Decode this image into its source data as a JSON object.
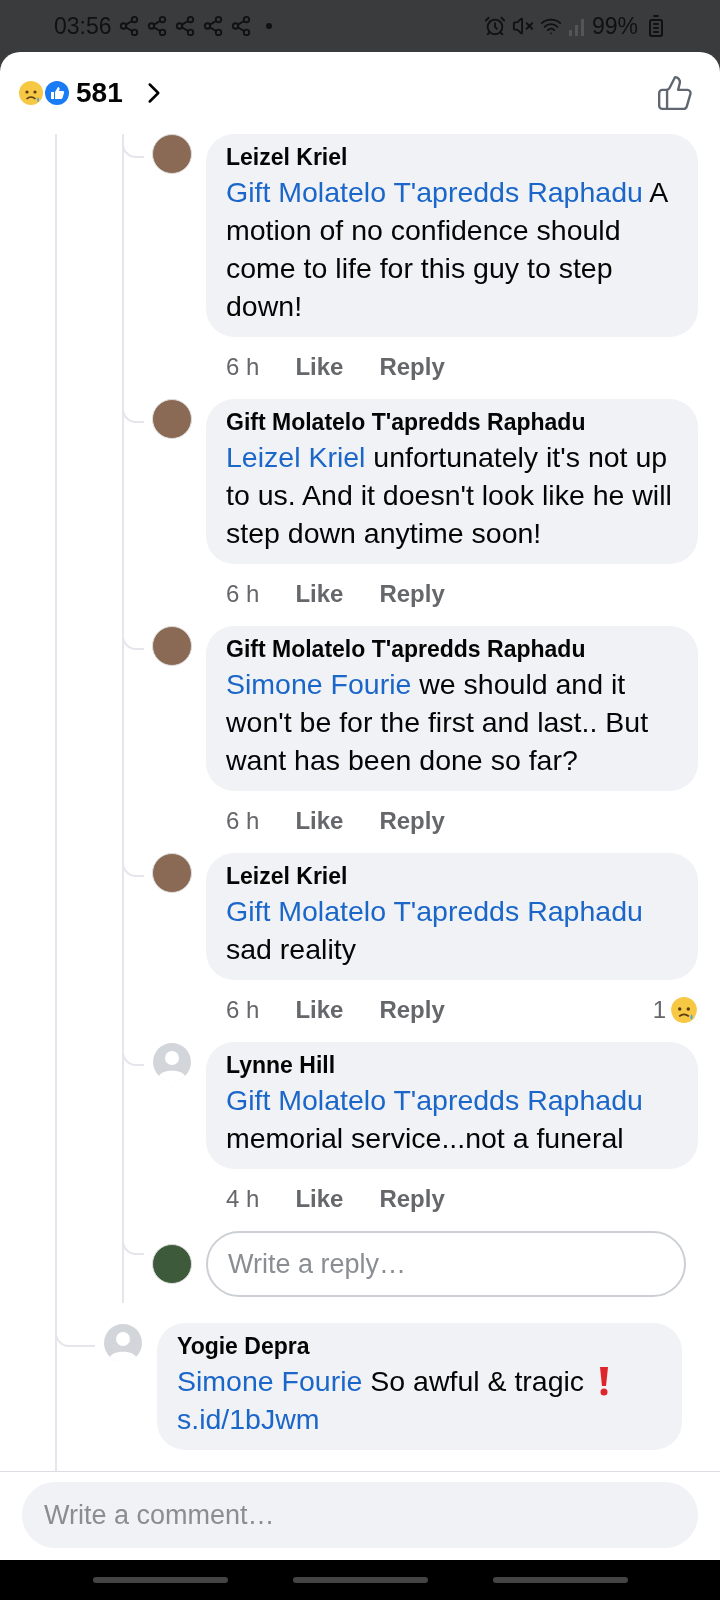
{
  "status_bar": {
    "time": "03:56",
    "battery": "99%"
  },
  "header": {
    "reaction_count": "581"
  },
  "replies": [
    {
      "author": "Leizel Kriel",
      "kind": "photo",
      "mention": "Gift Molatelo T'apredds Raphadu",
      "text": "A motion of no confidence should come to life for this guy to step down!",
      "time": "6 h",
      "like": "Like",
      "reply": "Reply"
    },
    {
      "author": "Gift Molatelo T'apredds Raphadu",
      "kind": "photo",
      "mention": "Leizel Kriel",
      "text": "unfortunately it's not up to us. And it doesn't look like he will step down anytime soon!",
      "time": "6 h",
      "like": "Like",
      "reply": "Reply"
    },
    {
      "author": "Gift Molatelo T'apredds Raphadu",
      "kind": "photo",
      "mention": "Simone Fourie",
      "text": "we should and it won't be for the first and last.. But want has been done so far?",
      "time": "6 h",
      "like": "Like",
      "reply": "Reply"
    },
    {
      "author": "Leizel Kriel",
      "kind": "photo",
      "mention": "Gift Molatelo T'apredds Raphadu",
      "text": "sad reality",
      "time": "6 h",
      "like": "Like",
      "reply": "Reply",
      "reaction_count": "1"
    },
    {
      "author": "Lynne Hill",
      "kind": "default",
      "mention": "Gift Molatelo T'apredds Raphadu",
      "text": "memorial service...not a funeral",
      "time": "4 h",
      "like": "Like",
      "reply": "Reply"
    }
  ],
  "reply_box": {
    "placeholder": "Write a reply…"
  },
  "next_comment": {
    "author": "Yogie Depra",
    "kind": "default",
    "mention": "Simone Fourie",
    "text": "So awful & tragic",
    "link": "s.id/1bJwm"
  },
  "comment_box": {
    "placeholder": "Write a comment…"
  }
}
